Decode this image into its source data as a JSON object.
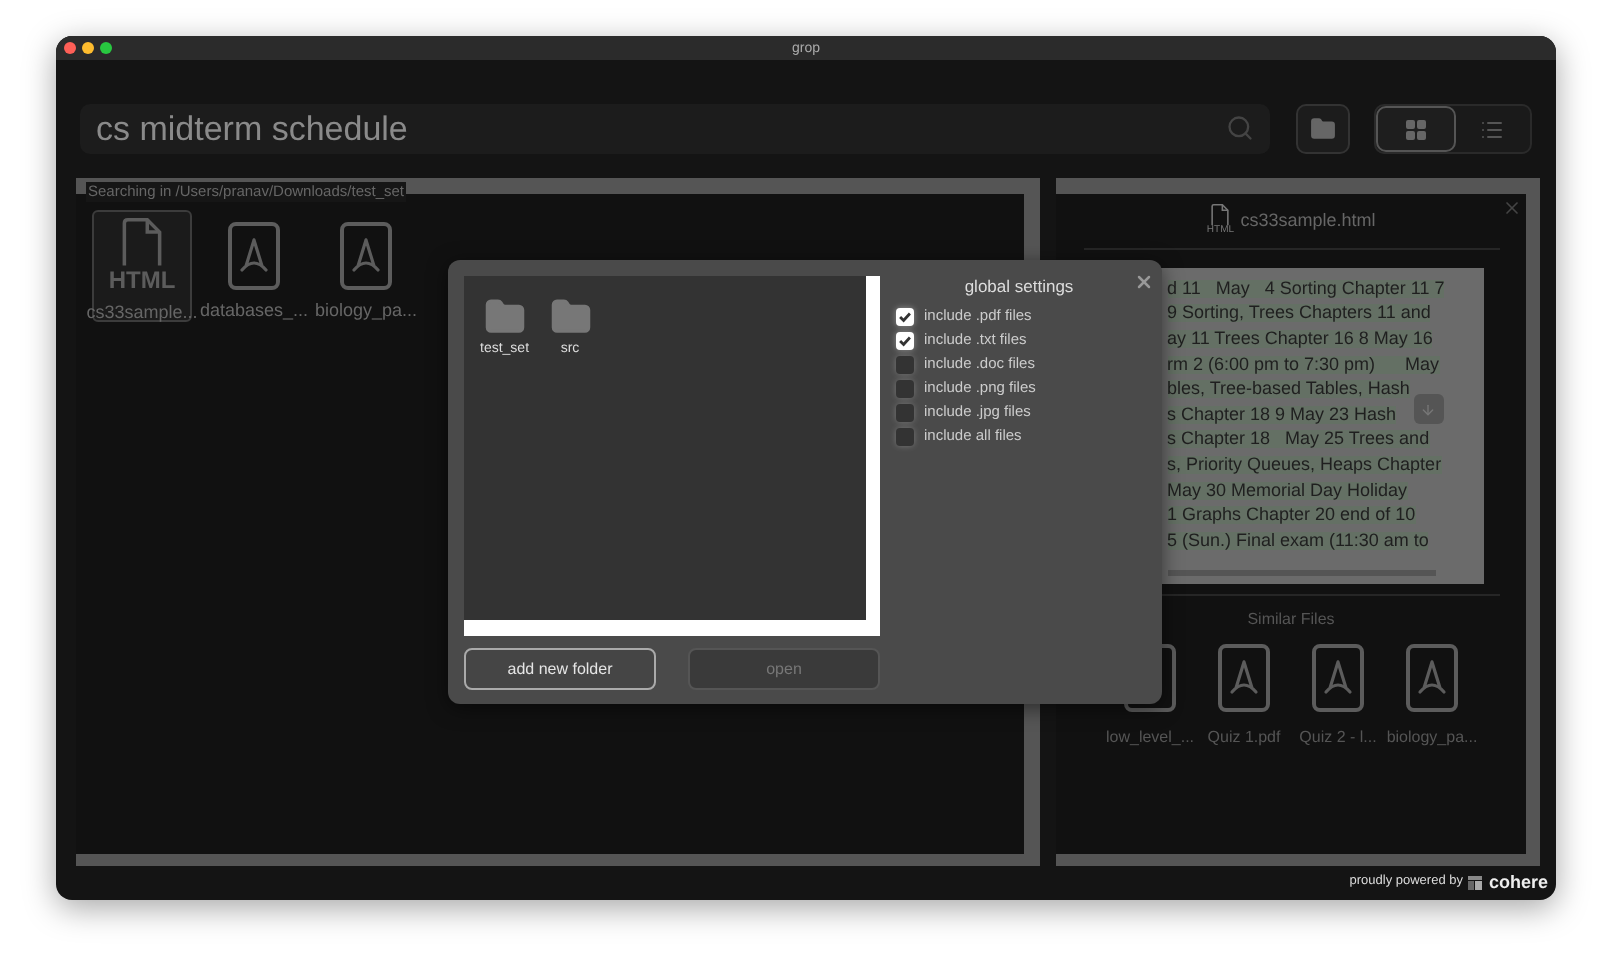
{
  "window": {
    "title": "grop"
  },
  "search": {
    "value": "cs midterm schedule"
  },
  "view_toggle": [
    {
      "kind": "grid",
      "selected": true
    },
    {
      "kind": "list",
      "selected": false
    }
  ],
  "search_location": "Searching in /Users/pranav/Downloads/test_set",
  "results": [
    {
      "kind": "html",
      "badge": "HTML",
      "name": "cs33sample...",
      "selected": true
    },
    {
      "kind": "pdf",
      "name": "databases_...",
      "selected": false
    },
    {
      "kind": "pdf",
      "name": "biology_pa...",
      "selected": false
    }
  ],
  "preview": {
    "badge": "HTML",
    "title": "cs33sample.html",
    "lines": [
      "d 11   May   4 Sorting Chapter 11 7",
      "9 Sorting, Trees Chapters 11 and",
      "ay 11 Trees Chapter 16 8 May 16",
      "rm 2 (6:00 pm to 7:30 pm)      May",
      "bles, Tree-based Tables, Hash",
      "s Chapter 18 9 May 23 Hash",
      "s Chapter 18   May 25 Trees and",
      "s, Priority Queues, Heaps Chapter",
      "May 30 Memorial Day Holiday",
      "1 Graphs Chapter 20 end of 10",
      "5 (Sun.) Final exam (11:30 am to"
    ]
  },
  "similar_files": {
    "title": "Similar Files",
    "items": [
      {
        "kind": "file",
        "name": "low_level_..."
      },
      {
        "kind": "pdf",
        "name": "Quiz 1.pdf"
      },
      {
        "kind": "pdf",
        "name": "Quiz 2 - l..."
      },
      {
        "kind": "pdf",
        "name": "biology_pa..."
      }
    ]
  },
  "dialog": {
    "folders": [
      "test_set",
      "src"
    ],
    "buttons": [
      {
        "label": "add new folder",
        "disabled": false
      },
      {
        "label": "open",
        "disabled": true
      }
    ],
    "settings": {
      "title": "global settings",
      "options": [
        {
          "label": "include .pdf files",
          "checked": true
        },
        {
          "label": "include .txt files",
          "checked": true
        },
        {
          "label": "include .doc files",
          "checked": false
        },
        {
          "label": "include .png files",
          "checked": false
        },
        {
          "label": "include .jpg files",
          "checked": false
        },
        {
          "label": "include all files",
          "checked": false
        }
      ]
    }
  },
  "footer": {
    "text": "proudly powered by",
    "brand": "cohere"
  }
}
